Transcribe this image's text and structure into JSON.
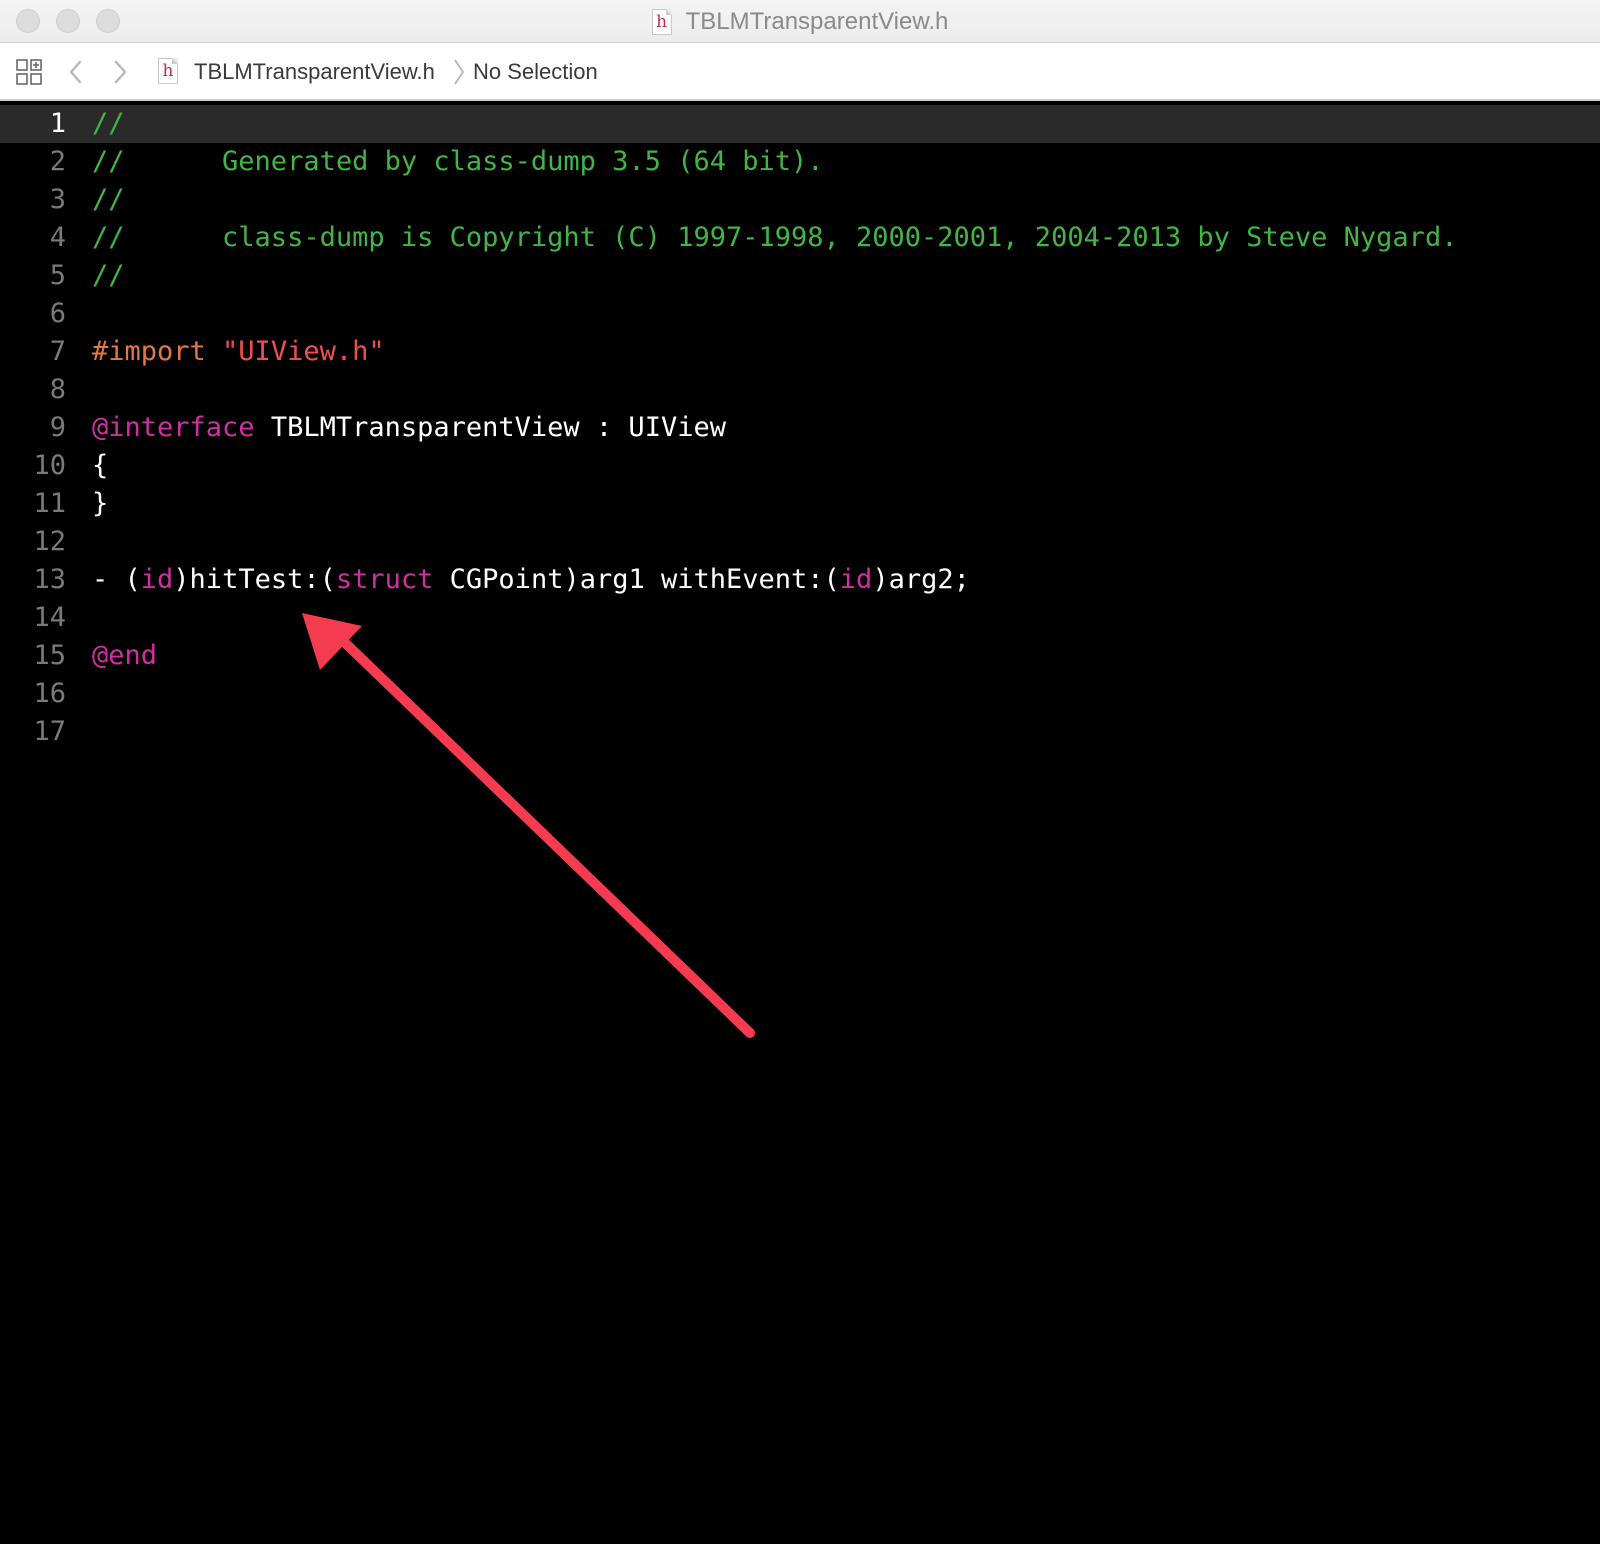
{
  "window": {
    "title": "TBLMTransparentView.h",
    "file_type_glyph": "h"
  },
  "jumpbar": {
    "file_name": "TBLMTransparentView.h",
    "selection": "No Selection",
    "file_type_glyph": "h"
  },
  "editor": {
    "current_line": 1,
    "colors": {
      "comment": "#41b645",
      "keyword": "#d12f9f",
      "preprocessor": "#e0794a",
      "string": "#ef4f4f",
      "plain": "#ffffff",
      "annotation_arrow": "#f53b4f"
    },
    "lines": [
      {
        "n": "1",
        "tokens": [
          {
            "t": "//",
            "k": "comment"
          }
        ]
      },
      {
        "n": "2",
        "tokens": [
          {
            "t": "//      Generated by class-dump 3.5 (64 bit).",
            "k": "comment"
          }
        ]
      },
      {
        "n": "3",
        "tokens": [
          {
            "t": "//",
            "k": "comment"
          }
        ]
      },
      {
        "n": "4",
        "tokens": [
          {
            "t": "//      class-dump is Copyright (C) 1997-1998, 2000-2001, 2004-2013 by Steve Nygard.",
            "k": "comment"
          }
        ]
      },
      {
        "n": "5",
        "tokens": [
          {
            "t": "//",
            "k": "comment"
          }
        ]
      },
      {
        "n": "6",
        "tokens": []
      },
      {
        "n": "7",
        "tokens": [
          {
            "t": "#import ",
            "k": "prep"
          },
          {
            "t": "\"UIView.h\"",
            "k": "string"
          }
        ]
      },
      {
        "n": "8",
        "tokens": []
      },
      {
        "n": "9",
        "tokens": [
          {
            "t": "@interface",
            "k": "keyword"
          },
          {
            "t": " TBLMTransparentView : UIView",
            "k": "plain"
          }
        ]
      },
      {
        "n": "10",
        "tokens": [
          {
            "t": "{",
            "k": "plain"
          }
        ]
      },
      {
        "n": "11",
        "tokens": [
          {
            "t": "}",
            "k": "plain"
          }
        ]
      },
      {
        "n": "12",
        "tokens": []
      },
      {
        "n": "13",
        "tokens": [
          {
            "t": "- (",
            "k": "plain"
          },
          {
            "t": "id",
            "k": "keyword"
          },
          {
            "t": ")hitTest:(",
            "k": "plain"
          },
          {
            "t": "struct",
            "k": "keyword"
          },
          {
            "t": " CGPoint)arg1 withEvent:(",
            "k": "plain"
          },
          {
            "t": "id",
            "k": "keyword"
          },
          {
            "t": ")arg2;",
            "k": "plain"
          }
        ]
      },
      {
        "n": "14",
        "tokens": []
      },
      {
        "n": "15",
        "tokens": [
          {
            "t": "@end",
            "k": "keyword"
          }
        ]
      },
      {
        "n": "16",
        "tokens": []
      },
      {
        "n": "17",
        "tokens": []
      }
    ]
  }
}
